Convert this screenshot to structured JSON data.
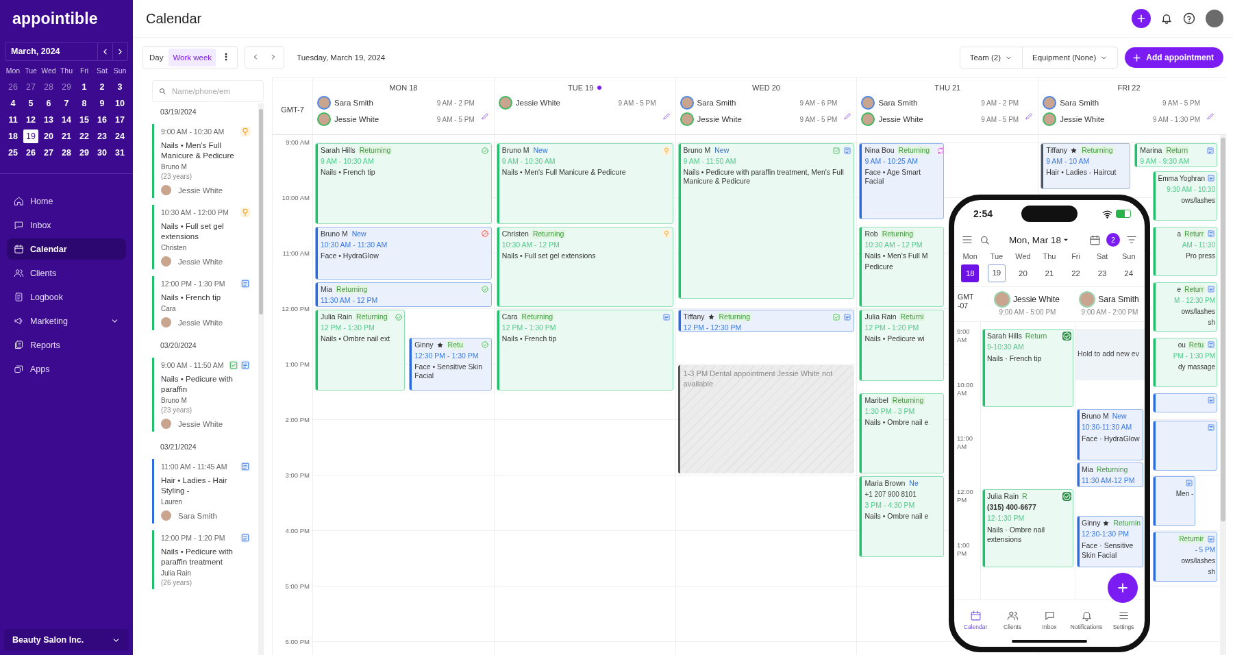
{
  "sidebar": {
    "logo": "appointible",
    "month": "March, 2024",
    "weekdays": [
      "Mon",
      "Tue",
      "Wed",
      "Thu",
      "Fri",
      "Sat",
      "Sun"
    ],
    "days": [
      {
        "label": "26",
        "muted": true,
        "selected": false
      },
      {
        "label": "27",
        "muted": true,
        "selected": false
      },
      {
        "label": "28",
        "muted": true,
        "selected": false
      },
      {
        "label": "29",
        "muted": true,
        "selected": false
      },
      {
        "label": "1",
        "muted": false,
        "selected": false
      },
      {
        "label": "2",
        "muted": false,
        "selected": false
      },
      {
        "label": "3",
        "muted": false,
        "selected": false
      },
      {
        "label": "4",
        "muted": false,
        "selected": false
      },
      {
        "label": "5",
        "muted": false,
        "selected": false
      },
      {
        "label": "6",
        "muted": false,
        "selected": false
      },
      {
        "label": "7",
        "muted": false,
        "selected": false
      },
      {
        "label": "8",
        "muted": false,
        "selected": false
      },
      {
        "label": "9",
        "muted": false,
        "selected": false
      },
      {
        "label": "10",
        "muted": false,
        "selected": false
      },
      {
        "label": "11",
        "muted": false,
        "selected": false
      },
      {
        "label": "12",
        "muted": false,
        "selected": false
      },
      {
        "label": "13",
        "muted": false,
        "selected": false
      },
      {
        "label": "14",
        "muted": false,
        "selected": false
      },
      {
        "label": "15",
        "muted": false,
        "selected": false
      },
      {
        "label": "16",
        "muted": false,
        "selected": false
      },
      {
        "label": "17",
        "muted": false,
        "selected": false
      },
      {
        "label": "18",
        "muted": false,
        "selected": false
      },
      {
        "label": "19",
        "muted": false,
        "selected": true
      },
      {
        "label": "20",
        "muted": false,
        "selected": false
      },
      {
        "label": "21",
        "muted": false,
        "selected": false
      },
      {
        "label": "22",
        "muted": false,
        "selected": false
      },
      {
        "label": "23",
        "muted": false,
        "selected": false
      },
      {
        "label": "24",
        "muted": false,
        "selected": false
      },
      {
        "label": "25",
        "muted": false,
        "selected": false
      },
      {
        "label": "26",
        "muted": false,
        "selected": false
      },
      {
        "label": "27",
        "muted": false,
        "selected": false
      },
      {
        "label": "28",
        "muted": false,
        "selected": false
      },
      {
        "label": "29",
        "muted": false,
        "selected": false
      },
      {
        "label": "30",
        "muted": false,
        "selected": false
      },
      {
        "label": "31",
        "muted": false,
        "selected": false
      }
    ],
    "nav": [
      {
        "label": "Home",
        "kind": "link",
        "selected": false
      },
      {
        "label": "Inbox",
        "kind": "link",
        "selected": false
      },
      {
        "label": "Calendar",
        "kind": "link",
        "selected": true
      },
      {
        "label": "Clients",
        "kind": "link",
        "selected": false
      },
      {
        "label": "Logbook",
        "kind": "link",
        "selected": false
      },
      {
        "label": "Marketing",
        "kind": "group",
        "selected": false
      },
      {
        "label": "Reports",
        "kind": "link",
        "selected": false
      },
      {
        "label": "Apps",
        "kind": "link",
        "selected": false
      }
    ],
    "footer": "Beauty Salon Inc."
  },
  "topbar": {
    "title": "Calendar"
  },
  "toolbar": {
    "views": [
      {
        "label": "Day",
        "selected": false
      },
      {
        "label": "Work week",
        "selected": true
      }
    ],
    "date": "Tuesday, March 19, 2024",
    "filters": [
      "Team (2)",
      "Equipment (None)"
    ],
    "add_button": "Add appointment"
  },
  "appointment_list": {
    "search_placeholder": "Name/phone/em",
    "groups": [
      {
        "date": "03/19/2024",
        "items": [
          {
            "time": "9:00 AM - 10:30 AM",
            "pending": true,
            "has_note": false,
            "checked_in": false,
            "service": "Nails • Men's Full Manicure & Pedicure",
            "client": "Bruno M",
            "age": "(23 years)",
            "staff": "Jessie White",
            "color": "#1fc16b"
          },
          {
            "time": "10:30 AM - 12:00 PM",
            "pending": true,
            "has_note": false,
            "checked_in": false,
            "service": "Nails • Full set gel extensions",
            "client": "Christen",
            "staff": "Jessie White",
            "color": "#1fc16b"
          },
          {
            "time": "12:00 PM - 1:30 PM",
            "pending": false,
            "has_note": true,
            "checked_in": false,
            "service": "Nails • French tip",
            "client": "Cara",
            "staff": "Jessie White",
            "color": "#1fc16b"
          }
        ]
      },
      {
        "date": "03/20/2024",
        "items": [
          {
            "time": "9:00 AM - 11:50 AM",
            "pending": false,
            "has_note": true,
            "checked_in": true,
            "service": "Nails • Pedicure with paraffin",
            "client": "Bruno M",
            "age": "(23 years)",
            "staff": "Jessie White",
            "color": "#1fc16b"
          }
        ]
      },
      {
        "date": "03/21/2024",
        "items": [
          {
            "time": "11:00 AM - 11:45 AM",
            "pending": false,
            "has_note": true,
            "checked_in": false,
            "service": "Hair • Ladies - Hair Styling -",
            "client": "Lauren",
            "staff": "Sara Smith",
            "color": "#2b6de0"
          },
          {
            "time": "12:00 PM - 1:20 PM",
            "pending": false,
            "has_note": true,
            "checked_in": false,
            "service": "Nails • Pedicure with paraffin treatment",
            "client": "Julia Rain",
            "age": "(26 years)",
            "color": "#1fc16b"
          }
        ]
      }
    ]
  },
  "calendar": {
    "timezone": "GMT-7",
    "hours": [
      "9:00 AM",
      "10:00 AM",
      "11:00 AM",
      "12:00 PM",
      "1:00 PM",
      "2:00 PM",
      "3:00 PM",
      "4:00 PM",
      "5:00 PM",
      "6:00 PM"
    ],
    "days": [
      {
        "label": "MON 18",
        "today": false,
        "staff": [
          {
            "name": "Sara Smith",
            "hours": "9 AM - 2 PM"
          },
          {
            "name": "Jessie White",
            "hours": "9 AM - 5 PM"
          }
        ],
        "events": [
          {
            "kind": "appointment",
            "client": "Sarah Hills",
            "new_client": false,
            "tag": "Returning",
            "starred": false,
            "time": "9 AM - 10:30 AM",
            "service": [
              "Nails • French tip"
            ],
            "confirmed": true,
            "cancelled": false,
            "color": "#1fc16b"
          },
          {
            "kind": "appointment",
            "client": "Bruno M",
            "new_client": true,
            "tag": "New",
            "starred": false,
            "time": "10:30 AM - 11:30 AM",
            "service": [
              "Face • HydraGlow"
            ],
            "confirmed": false,
            "cancelled": true,
            "color": "#2b6de0"
          },
          {
            "kind": "appointment",
            "client": "Mia",
            "new_client": false,
            "tag": "Returning",
            "starred": false,
            "time": "11:30 AM - 12 PM",
            "confirmed": true,
            "cancelled": false,
            "color": "#2b6de0"
          },
          {
            "kind": "appointment",
            "client": "Julia Rain",
            "new_client": false,
            "tag": "Returning",
            "starred": false,
            "time": "12 PM - 1:30 PM",
            "service": [
              "Nails • Ombre nail ext"
            ],
            "confirmed": true,
            "cancelled": false,
            "color": "#1fc16b"
          },
          {
            "kind": "appointment",
            "client": "Ginny",
            "new_client": false,
            "tag": "Retu",
            "starred": true,
            "time": "12:30 PM - 1:30 PM",
            "service": [
              "Face • Sensitive Skin Facial"
            ],
            "confirmed": true,
            "cancelled": false,
            "color": "#2b6de0"
          }
        ]
      },
      {
        "label": "TUE 19",
        "today": true,
        "staff": [
          {
            "name": "Jessie White",
            "hours": "9 AM - 5 PM"
          }
        ],
        "events": [
          {
            "kind": "appointment",
            "client": "Bruno M",
            "new_client": true,
            "tag": "New",
            "time": "9 AM - 10:30 AM",
            "service": [
              "Nails • Men's Full Manicure & Pedicure"
            ],
            "pending": true,
            "has_note": false,
            "color": "#1fc16b"
          },
          {
            "kind": "appointment",
            "client": "Christen",
            "new_client": false,
            "tag": "Returning",
            "time": "10:30 AM - 12 PM",
            "service": [
              "Nails • Full set gel extensions"
            ],
            "pending": true,
            "has_note": false,
            "color": "#1fc16b"
          },
          {
            "kind": "appointment",
            "client": "Cara",
            "new_client": false,
            "tag": "Returning",
            "time": "12 PM - 1:30 PM",
            "service": [
              "Nails • French tip"
            ],
            "pending": false,
            "has_note": true,
            "color": "#1fc16b"
          }
        ]
      },
      {
        "label": "WED 20",
        "today": false,
        "staff": [
          {
            "name": "Sara Smith",
            "hours": "9 AM - 6 PM"
          },
          {
            "name": "Jessie White",
            "hours": "9 AM - 5 PM"
          }
        ],
        "events": [
          {
            "kind": "appointment",
            "client": "Bruno M",
            "new_client": true,
            "tag": "New",
            "starred": false,
            "time": "9 AM - 11:50 AM",
            "service": [
              "Nails • Pedicure with paraffin treatment, Men's Full Manicure & Pedicure"
            ],
            "checked_in": true,
            "has_note": true,
            "color": "#1fc16b"
          },
          {
            "kind": "appointment",
            "client": "Tiffany",
            "new_client": false,
            "tag": "Returning",
            "starred": true,
            "time": "12 PM - 12:30 PM",
            "checked_in": true,
            "has_note": true,
            "color": "#2b6de0"
          },
          {
            "kind": "blocked",
            "text": "1-3 PM Dental appointment Jessie White not available",
            "color": "#555555"
          }
        ]
      },
      {
        "label": "THU 21",
        "today": false,
        "staff": [
          {
            "name": "Sara Smith",
            "hours": "9 AM - 2 PM"
          },
          {
            "name": "Jessie White",
            "hours": "9 AM - 5 PM"
          }
        ],
        "events": [
          {
            "kind": "appointment",
            "client": "Nina Bou",
            "new_client": false,
            "tag": "Returning",
            "time": "9 AM - 10:25 AM",
            "service": [
              "Face • Age Smart Facial"
            ],
            "recurring": true,
            "color": "#2b6de0"
          },
          {
            "kind": "appointment",
            "client": "Rob",
            "new_client": false,
            "tag": "Returning",
            "time": "10:30 AM - 12 PM",
            "service": [
              "Nails • Men's Full M",
              "Pedicure"
            ],
            "color": "#1fc16b"
          },
          {
            "kind": "appointment",
            "client": "Julia Rain",
            "new_client": false,
            "tag": "Returni",
            "time": "12 PM - 1:20 PM",
            "service": [
              "Nails • Pedicure wi"
            ],
            "color": "#1fc16b"
          },
          {
            "kind": "appointment",
            "client": "Maribel",
            "new_client": false,
            "tag": "Returning",
            "time": "1:30 PM - 3 PM",
            "service": [
              "Nails • Ombre nail e"
            ],
            "color": "#1fc16b"
          },
          {
            "kind": "appointment",
            "client": "Maria Brown",
            "new_client": true,
            "tag": "Ne",
            "phone": "+1 207 900 8101",
            "time": "3 PM - 4:30 PM",
            "service": [
              "Nails • Ombre nail e"
            ],
            "color": "#1fc16b"
          }
        ]
      },
      {
        "label": "FRI 22",
        "today": false,
        "staff": [
          {
            "name": "Sara Smith",
            "hours": "9 AM - 5 PM"
          },
          {
            "name": "Jessie White",
            "hours": "9 AM - 1:30 PM"
          }
        ],
        "events": [
          {
            "kind": "appointment",
            "client": "Tiffany",
            "new_client": false,
            "tag": "Returning",
            "starred": true,
            "time": "9 AM - 10 AM",
            "service": [
              "Hair • Ladies - Haircut"
            ],
            "has_note": false,
            "color": "#4b5563"
          },
          {
            "kind": "appointment",
            "client": "Marina",
            "new_client": false,
            "tag": "Return",
            "starred": false,
            "time": "9 AM - 9:30 AM",
            "has_note": true,
            "color": "#1fc16b"
          },
          {
            "kind": "fragment",
            "client": "Emma Yoghran",
            "time": "9:30 AM - 10:30",
            "service": [
              "ows/lashes"
            ],
            "has_note": true,
            "color": "#1fc16b"
          },
          {
            "kind": "fragment",
            "client": "a",
            "new_client": false,
            "tag": "Returr",
            "time": "AM - 11:30",
            "service": [
              "Pro press"
            ],
            "has_note": true,
            "color": "#1fc16b"
          },
          {
            "kind": "fragment",
            "client": "e",
            "new_client": false,
            "tag": "Returr",
            "time": "M - 12:30 PM",
            "service": [
              "ows/lashes",
              "sh"
            ],
            "has_note": true,
            "color": "#1fc16b"
          },
          {
            "kind": "fragment",
            "client": "ou",
            "new_client": false,
            "tag": "Retu",
            "time": "PM - 1:30 PM",
            "service": [
              "dy massage"
            ],
            "has_note": true,
            "color": "#1fc16b"
          },
          {
            "kind": "fragment",
            "has_note": true,
            "color": "#2b6de0"
          },
          {
            "kind": "fragment",
            "has_note": true,
            "color": "#2b6de0"
          },
          {
            "kind": "fragment",
            "service": [
              "Men -"
            ],
            "has_note": true,
            "color": "#2b6de0"
          },
          {
            "kind": "fragment",
            "new_client": false,
            "tag": "Returnir",
            "time": "- 5 PM",
            "service": [
              "ows/lashes",
              "sh"
            ],
            "has_note": true,
            "color": "#2b6de0"
          }
        ]
      }
    ]
  },
  "phone": {
    "clock": "2:54",
    "date": "Mon, Mar 18",
    "badge": "2",
    "week": [
      {
        "label": "Mon",
        "date": "18",
        "selected": true,
        "today": false
      },
      {
        "label": "Tue",
        "date": "19",
        "selected": false,
        "today": true
      },
      {
        "label": "Wed",
        "date": "20",
        "selected": false,
        "today": false
      },
      {
        "label": "Thu",
        "date": "21",
        "selected": false,
        "today": false
      },
      {
        "label": "Fri",
        "date": "22",
        "selected": false,
        "today": false
      },
      {
        "label": "Sat",
        "date": "23",
        "selected": false,
        "today": false
      },
      {
        "label": "Sun",
        "date": "24",
        "selected": false,
        "today": false
      }
    ],
    "timezone": "GMT -07",
    "staff": [
      {
        "name": "Jessie White",
        "hours": "9:00 AM - 5:00 PM"
      },
      {
        "name": "Sara Smith",
        "hours": "9:00 AM - 2:00 PM"
      }
    ],
    "hours": [
      "9:00 AM",
      "10:00 AM",
      "11:00 AM",
      "12:00 PM",
      "1:00 PM"
    ],
    "events": [
      {
        "kind": "appointment",
        "client": "Sarah Hills",
        "new_client": false,
        "tag": "Return",
        "starred": false,
        "confirmed": true,
        "time": "9-10:30 AM",
        "service": "Nails · French tip",
        "color": "#1fc16b"
      },
      {
        "kind": "hint",
        "text": "Hold to add new ev"
      },
      {
        "kind": "appointment",
        "client": "Bruno M",
        "new_client": true,
        "tag": "New",
        "starred": false,
        "confirmed": false,
        "time": "10:30-11:30 AM",
        "service": "Face · HydraGlow",
        "color": "#2b6de0"
      },
      {
        "kind": "appointment",
        "client": "Mia",
        "new_client": false,
        "tag": "Returning",
        "starred": false,
        "confirmed": false,
        "time": "11:30 AM-12 PM",
        "color": "#2b6de0"
      },
      {
        "kind": "appointment",
        "client": "Julia Rain",
        "phone": "(315) 400-6677",
        "new_client": false,
        "tag": "R",
        "starred": false,
        "confirmed": true,
        "time": "12-1:30 PM",
        "service": "Nails · Ombre nail extensions",
        "color": "#1fc16b"
      },
      {
        "kind": "appointment",
        "client": "Ginny",
        "new_client": false,
        "tag": "Returnin",
        "starred": true,
        "confirmed": false,
        "time": "12:30-1:30 PM",
        "service": "Face · Sensitive Skin Facial",
        "color": "#2b6de0"
      }
    ],
    "tabs": [
      {
        "label": "Calendar",
        "selected": true
      },
      {
        "label": "Clients",
        "selected": false
      },
      {
        "label": "Inbox",
        "selected": false
      },
      {
        "label": "Notifications",
        "selected": false
      },
      {
        "label": "Settings",
        "selected": false
      }
    ]
  }
}
